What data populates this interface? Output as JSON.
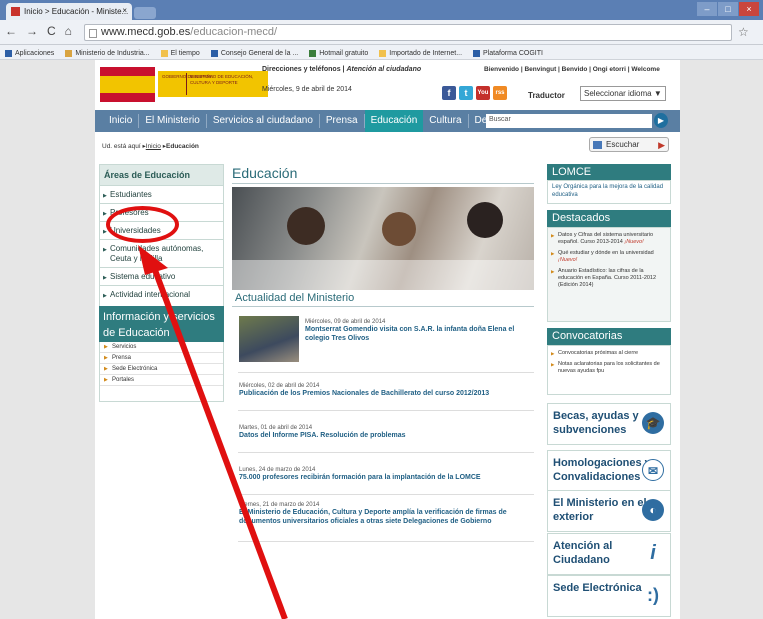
{
  "browser": {
    "tab_title": "Inicio > Educación - Ministe...",
    "tab_close": "×",
    "url_host": "www.mecd.gob.es",
    "url_path": "/educacion-mecd/",
    "nav": {
      "back": "←",
      "forward": "→",
      "reload": "C",
      "home": "⌂"
    },
    "star": "☆",
    "window_buttons": [
      "–",
      "□",
      "×"
    ],
    "bookmarks": [
      "Aplicaciones",
      "Ministerio de Industria...",
      "El tiempo",
      "Consejo General de la ...",
      "Hotmail gratuito",
      "Importado de Internet...",
      "Plataforma COGITI"
    ]
  },
  "header": {
    "gob_left": "Gobierno de España",
    "gob_right": "Ministerio de Educación, Cultura y Deporte",
    "top_links": "Direcciones y teléfonos | Atención al ciudadano",
    "top_links_a": "Direcciones y teléfonos",
    "top_links_b": "Atención al ciudadano",
    "welcome": "Bienvenido | Benvingut | Benvido | Ongi etorri | Welcome",
    "date": "Miércoles, 9 de abril de 2014",
    "social": [
      "f",
      "t",
      "You",
      "rss"
    ],
    "traductor_label": "Traductor",
    "language_select": "Seleccionar idioma ▼"
  },
  "mainnav": {
    "items": [
      "Inicio",
      "El Ministerio",
      "Servicios al ciudadano",
      "Prensa",
      "Educación",
      "Cultura",
      "Deporte"
    ],
    "active": "Educación",
    "search_placeholder": "Buscar",
    "search_button": "▶"
  },
  "breadcrumb": {
    "prefix": "Ud. está aquí",
    "home": "Inicio",
    "current": "Educación"
  },
  "escuchar": {
    "label": "Escuchar",
    "play": "▶"
  },
  "sidebar": {
    "title": "Áreas de Educación",
    "items": [
      "Estudiantes",
      "Profesores",
      "Universidades",
      "Comunidades autónomas, Ceuta y Melilla",
      "Sistema educativo",
      "Actividad internacional"
    ],
    "info_title": "Información y servicios de Educación",
    "info_links": [
      "Servicios",
      "Prensa",
      "Sede Electrónica",
      "Portales"
    ]
  },
  "main": {
    "title": "Educación",
    "news_section": "Actualidad del Ministerio",
    "news": [
      {
        "date": "Miércoles, 09 de abril de 2014",
        "title": "Montserrat Gomendio visita con S.A.R. la infanta doña Elena el colegio Tres Olivos"
      },
      {
        "date": "Miércoles, 02 de abril de 2014",
        "title": "Publicación de los Premios Nacionales de Bachillerato del curso 2012/2013"
      },
      {
        "date": "Martes, 01 de abril de 2014",
        "title": "Datos del Informe PISA. Resolución de problemas"
      },
      {
        "date": "Lunes, 24 de marzo de 2014",
        "title": "75.000 profesores recibirán formación para la implantación de la LOMCE"
      },
      {
        "date": "Viernes, 21 de marzo de 2014",
        "title": "El Ministerio de Educación, Cultura y Deporte amplía la verificación de firmas de documentos universitarios oficiales a otras siete Delegaciones de Gobierno"
      }
    ]
  },
  "right": {
    "lomce_title": "LOMCE",
    "lomce_text": "Ley Orgánica para la mejora de la calidad educativa",
    "destacados_title": "Destacados",
    "destacados": [
      {
        "text": "Datos y Cifras del sistema universitario español. Curso 2013-2014",
        "new": "¡Nuevo!"
      },
      {
        "text": "Qué estudiar y dónde en la universidad",
        "new": "¡Nuevo!"
      },
      {
        "text": "Anuario Estadístico: las cifras de la educación en España. Curso 2011-2012 (Edición 2014)",
        "new": ""
      }
    ],
    "convocatorias_title": "Convocatorias",
    "convocatorias": [
      "Convocatorias próximas al cierre",
      "Notas aclaratorias para los solicitantes de nuevas ayudas fpu"
    ],
    "tiles": [
      {
        "label": "Becas, ayudas y subvenciones",
        "icon": "graduation-cap-icon"
      },
      {
        "label": "Homologaciones y Convalidaciones",
        "icon": "certificate-icon"
      },
      {
        "label": "El Ministerio en el exterior",
        "icon": "globe-icon"
      },
      {
        "label": "Atención al Ciudadano",
        "icon": "info-icon"
      },
      {
        "label": "Sede Electrónica",
        "icon": "smile-icon"
      }
    ]
  },
  "annotation": {
    "color": "#e01010"
  }
}
